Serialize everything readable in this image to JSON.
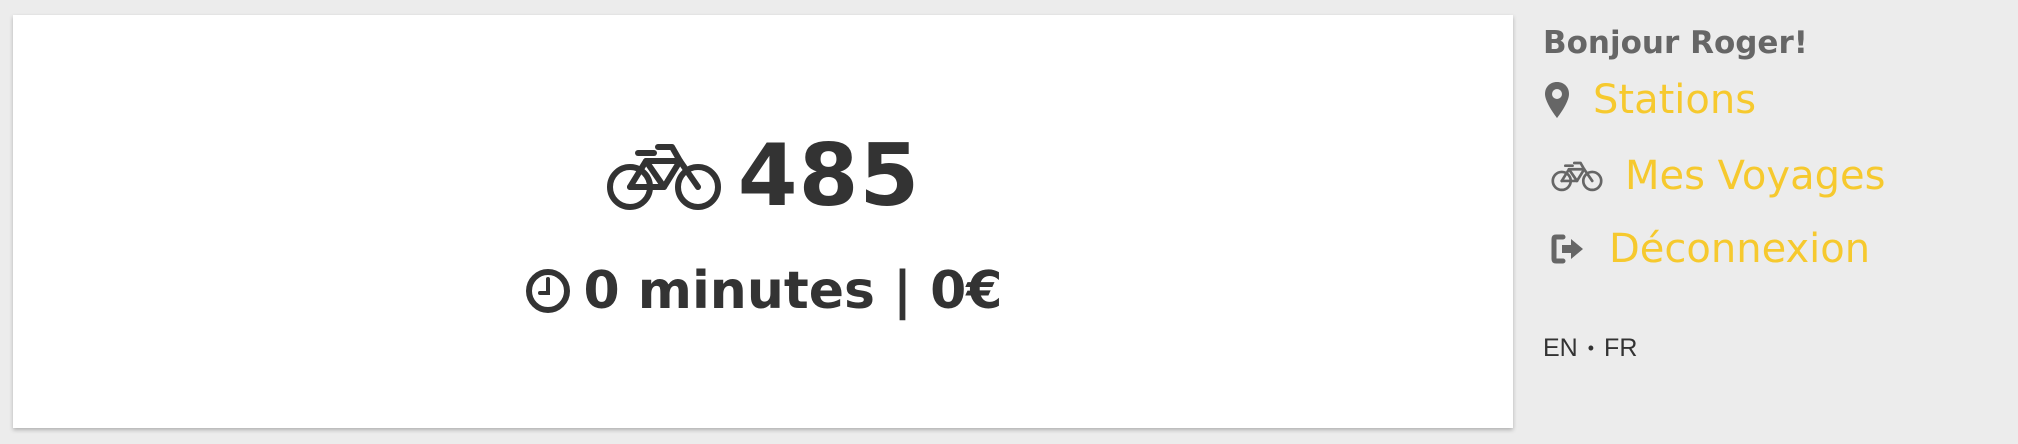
{
  "dashboard": {
    "ride_count": "485",
    "ride_info": "0 minutes | 0€"
  },
  "sidebar": {
    "greeting": "Bonjour Roger!",
    "nav": {
      "stations": "Stations",
      "trips": "Mes Voyages",
      "logout": "Déconnexion"
    },
    "languages": {
      "en": "EN",
      "separator": "•",
      "fr": "FR"
    }
  },
  "colors": {
    "background": "#ececec",
    "card": "#ffffff",
    "text_dark": "#333333",
    "text_gray": "#666666",
    "accent_yellow": "#f6c92e"
  },
  "icons": {
    "ride_count": "bicycle-icon",
    "ride_info": "clock-icon",
    "stations": "map-marker-icon",
    "trips": "bicycle-icon",
    "logout": "sign-out-icon"
  }
}
